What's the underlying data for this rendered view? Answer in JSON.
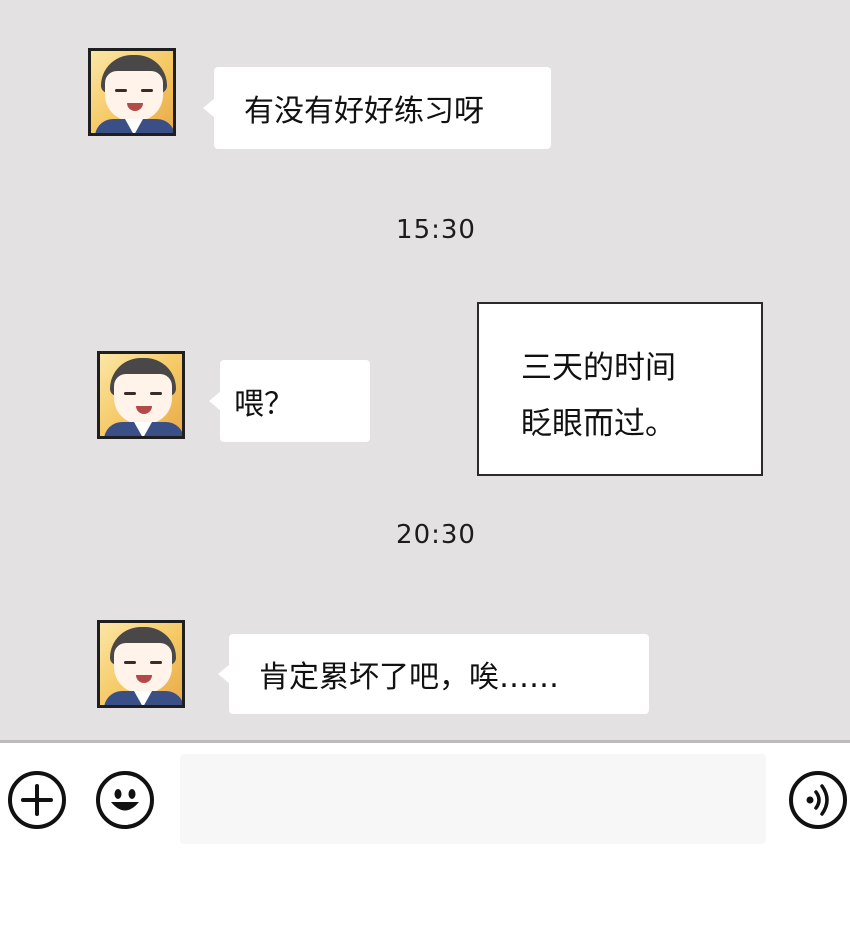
{
  "messages": [
    {
      "text": "有没有好好练习呀"
    },
    {
      "text": "喂？"
    },
    {
      "text": "肯定累坏了吧，唉……"
    }
  ],
  "timestamps": [
    "15:30",
    "20:30"
  ],
  "narration": {
    "line1": "三天的时间",
    "line2": "眨眼而过。"
  },
  "input_bar": {
    "icons": [
      "plus-icon",
      "emoji-icon",
      "voice-icon"
    ],
    "input_value": ""
  },
  "colors": {
    "chat_background": "#e3e1e2",
    "bubble": "#ffffff",
    "input_background": "#f7f7f7"
  }
}
